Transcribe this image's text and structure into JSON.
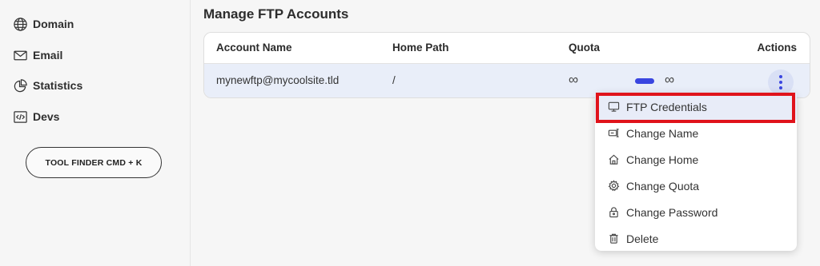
{
  "sidebar": {
    "items": [
      {
        "label": "Domain",
        "icon": "globe-icon"
      },
      {
        "label": "Email",
        "icon": "envelope-icon"
      },
      {
        "label": "Statistics",
        "icon": "pie-chart-icon"
      },
      {
        "label": "Devs",
        "icon": "code-icon"
      }
    ],
    "tool_finder_label": "TOOL FINDER CMD + K"
  },
  "main": {
    "title": "Manage FTP Accounts",
    "table": {
      "headers": [
        "Account Name",
        "Home Path",
        "Quota",
        "Actions"
      ],
      "rows": [
        {
          "account": "mynewftp@mycoolsite.tld",
          "home_path": "/",
          "quota_used": "∞",
          "quota_limit": "∞"
        }
      ]
    }
  },
  "actions_menu": {
    "items": [
      {
        "label": "FTP Credentials",
        "icon": "monitor-icon"
      },
      {
        "label": "Change Name",
        "icon": "rename-icon"
      },
      {
        "label": "Change Home",
        "icon": "home-icon"
      },
      {
        "label": "Change Quota",
        "icon": "gear-icon"
      },
      {
        "label": "Change Password",
        "icon": "lock-icon"
      },
      {
        "label": "Delete",
        "icon": "trash-icon"
      }
    ]
  },
  "colors": {
    "accent": "#3a46e0",
    "highlight_box": "#e0131b",
    "row_background": "#e9eef9"
  }
}
